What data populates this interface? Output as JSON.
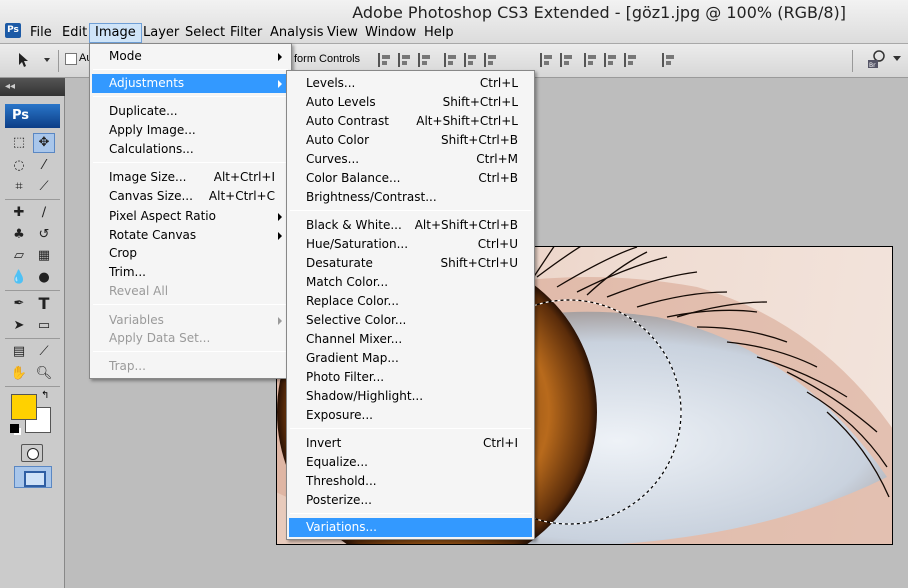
{
  "window": {
    "title": "Adobe Photoshop CS3 Extended - [göz1.jpg @ 100% (RGB/8)]",
    "app_icon_text": "Ps"
  },
  "menubar": {
    "items": [
      "File",
      "Edit",
      "Image",
      "Layer",
      "Select",
      "Filter",
      "Analysis",
      "View",
      "Window",
      "Help"
    ],
    "active": "Image"
  },
  "options_bar": {
    "auto_select_label": "Au",
    "transform_controls_label": "form Controls",
    "bridge_icon_text": "Br"
  },
  "tools": {
    "header": "◂◂",
    "logo_text": "Ps",
    "foreground_color": "#ffd100",
    "background_color": "#ffffff",
    "icons": [
      "marquee-icon",
      "move-icon",
      "lasso-icon",
      "magic-wand-icon",
      "crop-icon",
      "eyedropper-icon",
      "healing-icon",
      "brush-icon",
      "clone-stamp-icon",
      "history-brush-icon",
      "eraser-icon",
      "gradient-icon",
      "blur-icon",
      "dodge-icon",
      "pen-icon",
      "type-icon",
      "path-selection-icon",
      "shape-icon",
      "notes-icon",
      "eyedropper-icon",
      "hand-icon",
      "zoom-icon"
    ]
  },
  "image_menu": {
    "items": [
      {
        "label": "Mode",
        "submenu": true
      },
      {
        "label": "Adjustments",
        "submenu": true,
        "highlighted": true
      },
      {
        "label": "Duplicate..."
      },
      {
        "label": "Apply Image..."
      },
      {
        "label": "Calculations..."
      },
      {
        "label": "Image Size...",
        "shortcut": "Alt+Ctrl+I"
      },
      {
        "label": "Canvas Size...",
        "shortcut": "Alt+Ctrl+C"
      },
      {
        "label": "Pixel Aspect Ratio",
        "submenu": true
      },
      {
        "label": "Rotate Canvas",
        "submenu": true
      },
      {
        "label": "Crop"
      },
      {
        "label": "Trim..."
      },
      {
        "label": "Reveal All",
        "disabled": true
      },
      {
        "label": "Variables",
        "submenu": true,
        "disabled": true
      },
      {
        "label": "Apply Data Set...",
        "disabled": true
      },
      {
        "label": "Trap...",
        "disabled": true
      }
    ]
  },
  "adjustments_menu": {
    "items": [
      {
        "label": "Levels...",
        "shortcut": "Ctrl+L"
      },
      {
        "label": "Auto Levels",
        "shortcut": "Shift+Ctrl+L"
      },
      {
        "label": "Auto Contrast",
        "shortcut": "Alt+Shift+Ctrl+L"
      },
      {
        "label": "Auto Color",
        "shortcut": "Shift+Ctrl+B"
      },
      {
        "label": "Curves...",
        "shortcut": "Ctrl+M"
      },
      {
        "label": "Color Balance...",
        "shortcut": "Ctrl+B"
      },
      {
        "label": "Brightness/Contrast..."
      },
      {
        "label": "Black & White...",
        "shortcut": "Alt+Shift+Ctrl+B"
      },
      {
        "label": "Hue/Saturation...",
        "shortcut": "Ctrl+U"
      },
      {
        "label": "Desaturate",
        "shortcut": "Shift+Ctrl+U"
      },
      {
        "label": "Match Color..."
      },
      {
        "label": "Replace Color..."
      },
      {
        "label": "Selective Color..."
      },
      {
        "label": "Channel Mixer..."
      },
      {
        "label": "Gradient Map..."
      },
      {
        "label": "Photo Filter..."
      },
      {
        "label": "Shadow/Highlight..."
      },
      {
        "label": "Exposure..."
      },
      {
        "label": "Invert",
        "shortcut": "Ctrl+I"
      },
      {
        "label": "Equalize..."
      },
      {
        "label": "Threshold..."
      },
      {
        "label": "Posterize..."
      },
      {
        "label": "Variations...",
        "highlighted": true
      }
    ]
  },
  "colors": {
    "highlight": "#3399ff",
    "menu_bg": "#f5f5f5",
    "disabled_text": "#9a9a9a"
  }
}
